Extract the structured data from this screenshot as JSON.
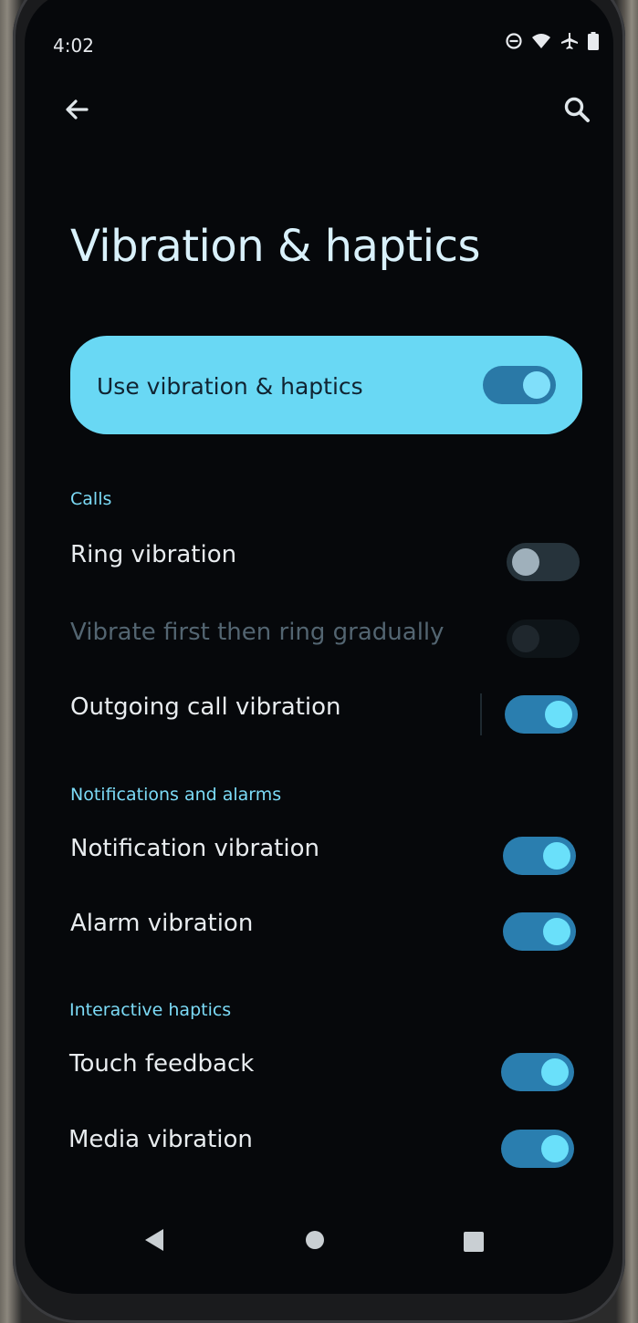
{
  "status_bar": {
    "time": "4:02",
    "icons": [
      "do-not-disturb-icon",
      "wifi-icon",
      "airplane-icon",
      "battery-icon"
    ]
  },
  "top_bar": {
    "back_icon": "back-arrow-icon",
    "search_icon": "search-icon"
  },
  "page": {
    "title": "Vibration & haptics"
  },
  "main_toggle": {
    "label": "Use vibration & haptics",
    "on": true
  },
  "sections": [
    {
      "header": "Calls",
      "items": [
        {
          "label": "Ring vibration",
          "on": false,
          "enabled": true
        },
        {
          "label": "Vibrate first then ring gradually",
          "on": false,
          "enabled": false
        },
        {
          "label": "Outgoing call vibration",
          "on": true,
          "enabled": true
        }
      ]
    },
    {
      "header": "Notifications and alarms",
      "items": [
        {
          "label": "Notification vibration",
          "on": true,
          "enabled": true
        },
        {
          "label": "Alarm vibration",
          "on": true,
          "enabled": true
        }
      ]
    },
    {
      "header": "Interactive haptics",
      "items": [
        {
          "label": "Touch feedback",
          "on": true,
          "enabled": true
        },
        {
          "label": "Media vibration",
          "on": true,
          "enabled": true
        }
      ]
    }
  ],
  "nav_bar": {
    "buttons": [
      "nav-back-icon",
      "nav-home-icon",
      "nav-recents-icon"
    ]
  },
  "colors": {
    "accent": "#69d8f4",
    "switch_on_track": "#2a7eaf",
    "switch_on_thumb": "#6ae0fa",
    "section_header": "#7cdbf7",
    "background": "#06080b"
  }
}
